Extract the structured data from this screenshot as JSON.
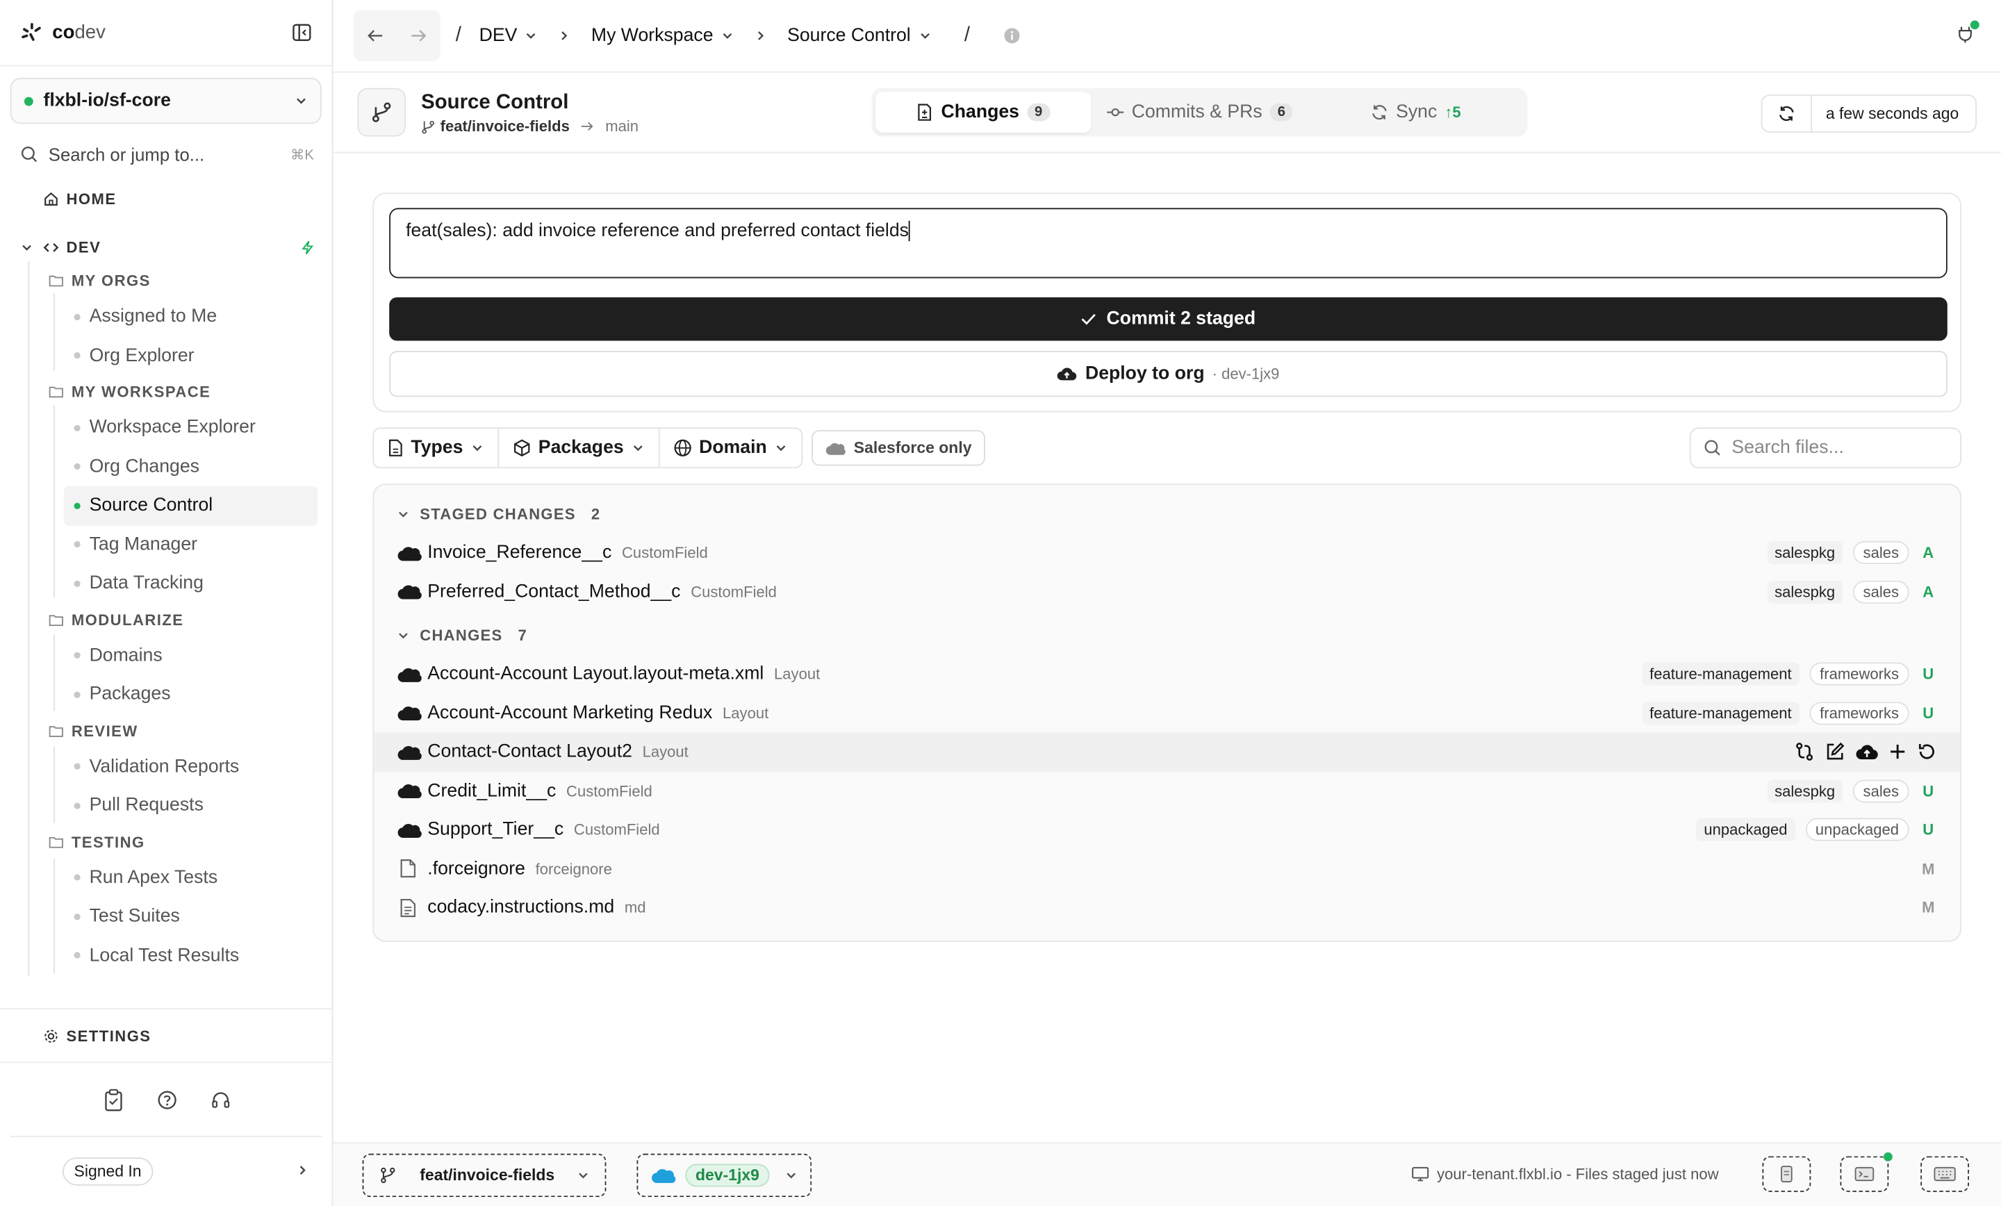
{
  "app": {
    "name_part1": "co",
    "name_part2": "dev"
  },
  "repo": {
    "name": "flxbl-io/sf-core",
    "status_color": "#22b35e"
  },
  "search": {
    "placeholder": "Search or jump to...",
    "shortcut": "⌘K"
  },
  "nav": {
    "home": "HOME",
    "dev": "DEV",
    "my_orgs": {
      "label": "MY ORGS",
      "items": [
        "Assigned to Me",
        "Org Explorer"
      ]
    },
    "my_workspace": {
      "label": "MY WORKSPACE",
      "items": [
        "Workspace Explorer",
        "Org Changes",
        "Source Control",
        "Tag Manager",
        "Data Tracking"
      ]
    },
    "modularize": {
      "label": "MODULARIZE",
      "items": [
        "Domains",
        "Packages"
      ]
    },
    "review": {
      "label": "REVIEW",
      "items": [
        "Validation Reports",
        "Pull Requests"
      ]
    },
    "testing": {
      "label": "TESTING",
      "items": [
        "Run Apex Tests",
        "Test Suites",
        "Local Test Results"
      ]
    },
    "settings": "SETTINGS",
    "signed_in": "Signed In"
  },
  "breadcrumb": {
    "sep": "/",
    "env": "DEV",
    "workspace": "My Workspace",
    "page": "Source Control"
  },
  "header": {
    "title": "Source Control",
    "branch": "feat/invoice-fields",
    "target": "main",
    "tabs": [
      {
        "label": "Changes",
        "badge": "9"
      },
      {
        "label": "Commits & PRs",
        "badge": "6"
      },
      {
        "label": "Sync",
        "badge": "↑5"
      }
    ],
    "last_refresh": "a few seconds ago"
  },
  "commit": {
    "message": "feat(sales): add invoice reference and preferred contact fields",
    "commit_label": "Commit 2 staged",
    "deploy_label": "Deploy to org",
    "deploy_org": "· dev-1jx9"
  },
  "filters": {
    "types": "Types",
    "packages": "Packages",
    "domain": "Domain",
    "sf_only": "Salesforce only",
    "search_placeholder": "Search files..."
  },
  "staged": {
    "label": "STAGED CHANGES",
    "count": "2",
    "rows": [
      {
        "name": "Invoice_Reference__c",
        "type": "CustomField",
        "pkg": "salespkg",
        "domain": "sales",
        "status": "A"
      },
      {
        "name": "Preferred_Contact_Method__c",
        "type": "CustomField",
        "pkg": "salespkg",
        "domain": "sales",
        "status": "A"
      }
    ]
  },
  "changes": {
    "label": "CHANGES",
    "count": "7",
    "rows": [
      {
        "name": "Account-Account Layout.layout-meta.xml",
        "type": "Layout",
        "pkg": "feature-management",
        "domain": "frameworks",
        "status": "U"
      },
      {
        "name": "Account-Account Marketing Redux",
        "type": "Layout",
        "pkg": "feature-management",
        "domain": "frameworks",
        "status": "U"
      },
      {
        "name": "Contact-Contact Layout2",
        "type": "Layout"
      },
      {
        "name": "Credit_Limit__c",
        "type": "CustomField",
        "pkg": "salespkg",
        "domain": "sales",
        "status": "U"
      },
      {
        "name": "Support_Tier__c",
        "type": "CustomField",
        "pkg": "unpackaged",
        "domain": "unpackaged",
        "status": "U"
      },
      {
        "name": ".forceignore",
        "type": "forceignore",
        "status": "M"
      },
      {
        "name": "codacy.instructions.md",
        "type": "md",
        "status": "M"
      }
    ]
  },
  "bottom": {
    "branch": "feat/invoice-fields",
    "org": "dev-1jx9",
    "status": "your-tenant.flxbl.io - Files staged just now"
  }
}
